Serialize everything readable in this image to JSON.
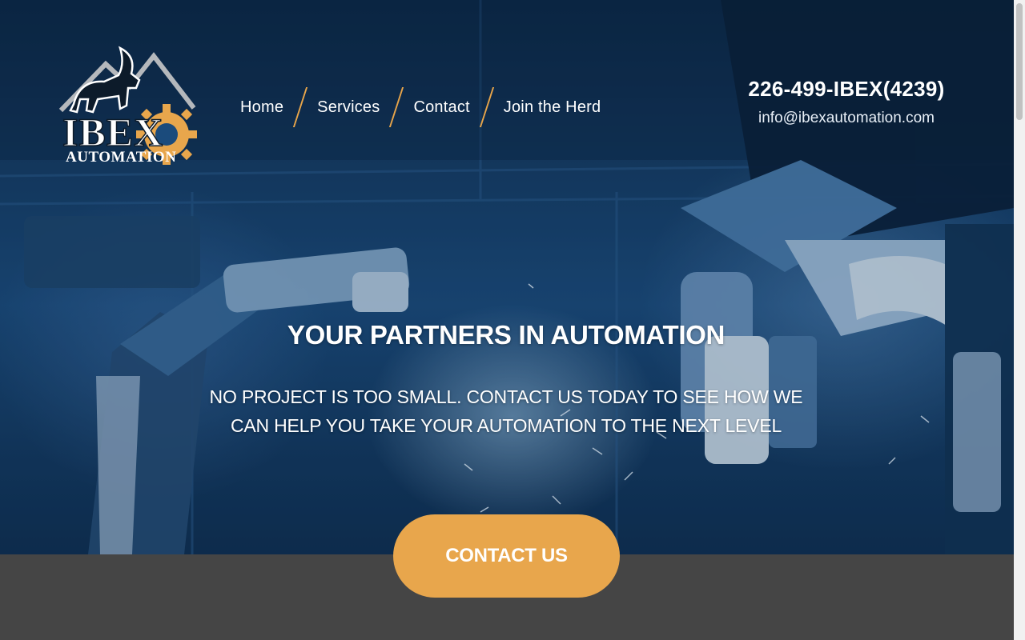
{
  "logo": {
    "text_top": "IBEX",
    "text_bottom": "AUTOMATION",
    "icon": "ibex-goat-gear-logo"
  },
  "nav": {
    "items": [
      {
        "label": "Home"
      },
      {
        "label": "Services"
      },
      {
        "label": "Contact"
      },
      {
        "label": "Join the Herd"
      }
    ]
  },
  "contact": {
    "phone": "226-499-IBEX(4239)",
    "email": "info@ibexautomation.com"
  },
  "hero": {
    "headline": "YOUR PARTNERS IN AUTOMATION",
    "subline_1": "NO PROJECT IS TOO SMALL. CONTACT US TODAY TO SEE HOW WE",
    "subline_2": "CAN HELP YOU TAKE YOUR AUTOMATION TO THE NEXT LEVEL",
    "cta_label": "CONTACT US"
  },
  "colors": {
    "accent": "#e8a64c",
    "hero_blue": "#1b4b7c",
    "band_gray": "#454545"
  }
}
